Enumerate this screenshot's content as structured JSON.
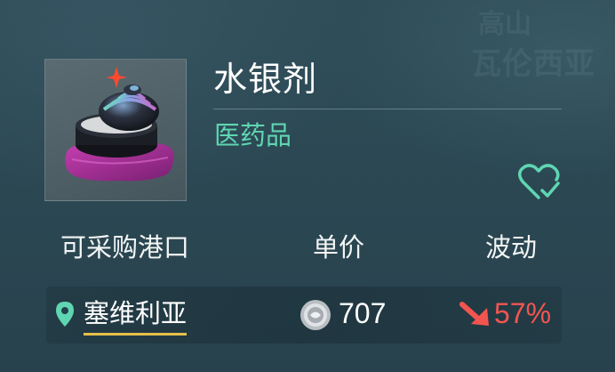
{
  "background_text": {
    "top": "高山",
    "mid": "瓦伦西亚"
  },
  "item": {
    "name": "水银剂",
    "category": "医药品",
    "icon": "mercury-container-icon"
  },
  "favorite": {
    "icon": "heart-check-icon",
    "color": "#5fd6b2"
  },
  "table": {
    "headers": {
      "port": "可采购港口",
      "price": "单价",
      "change": "波动"
    },
    "rows": [
      {
        "port": "塞维利亚",
        "price": "707",
        "change": "57%",
        "trend": "down"
      }
    ]
  },
  "colors": {
    "accent_green": "#5fd6b2",
    "link_underline": "#e5c04a",
    "down_red": "#f2554f"
  }
}
